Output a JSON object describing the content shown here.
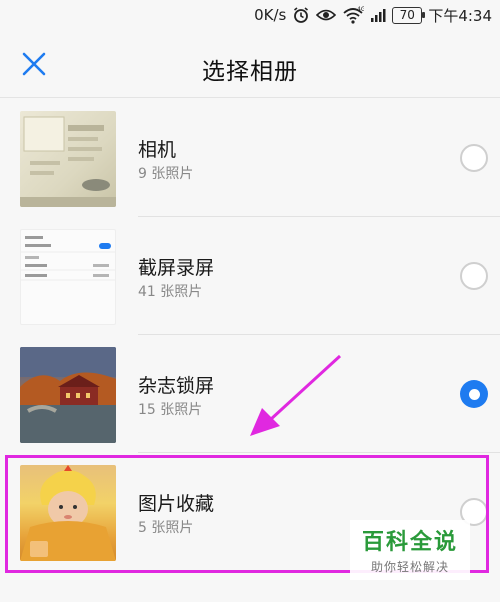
{
  "status_bar": {
    "network_speed": "0K/s",
    "network_type": "4G",
    "battery": "70",
    "time": "下午4:34",
    "icons": [
      "alarm-icon",
      "eye-icon",
      "wifi-icon",
      "signal-icon",
      "battery-icon"
    ]
  },
  "header": {
    "close_icon": "close-icon",
    "title": "选择相册"
  },
  "albums": [
    {
      "name": "相机",
      "count": "9 张照片",
      "selected": false
    },
    {
      "name": "截屏录屏",
      "count": "41 张照片",
      "selected": false
    },
    {
      "name": "杂志锁屏",
      "count": "15 张照片",
      "selected": true
    },
    {
      "name": "图片收藏",
      "count": "5 张照片",
      "selected": false
    }
  ],
  "colors": {
    "accent": "#1e7bf0",
    "highlight": "#e028e0",
    "watermark_green": "#2a9a3a"
  },
  "watermark": {
    "title": "百科全说",
    "subtitle": "助你轻松解决"
  }
}
